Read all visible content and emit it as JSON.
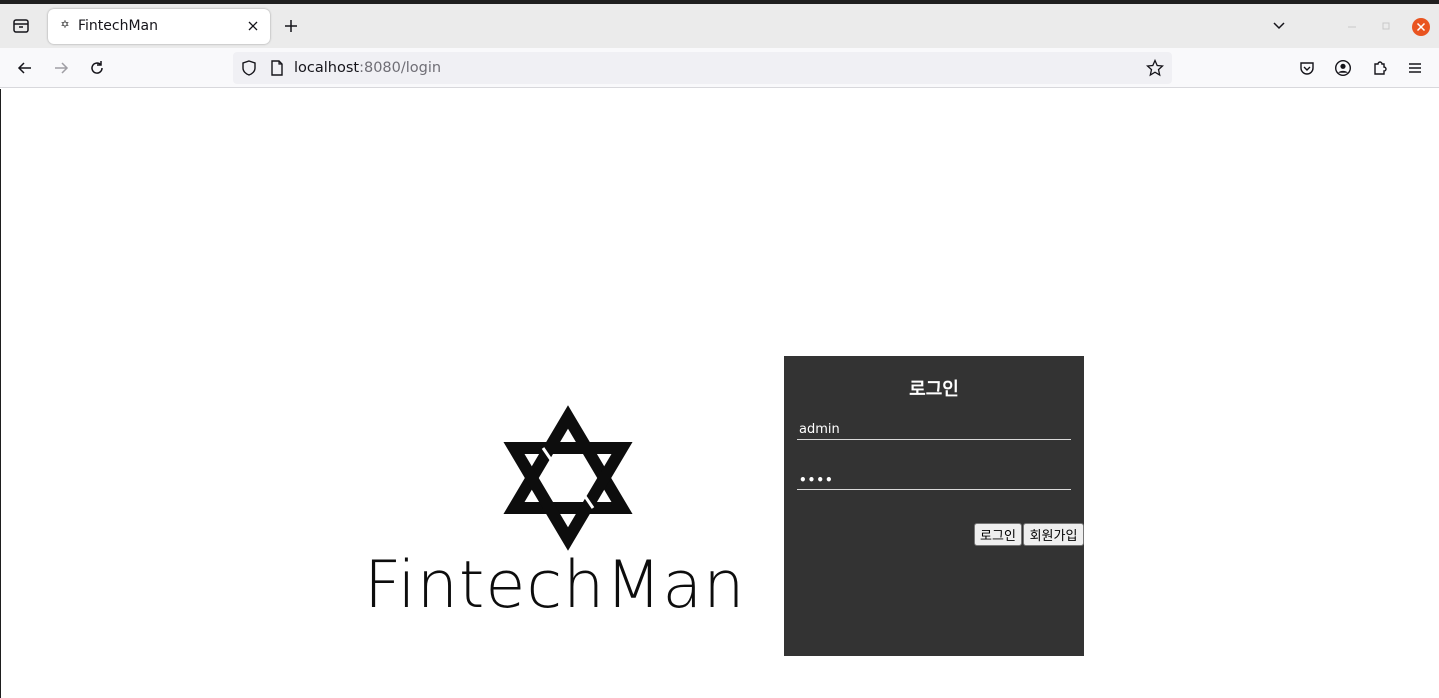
{
  "browser": {
    "tab": {
      "title": "FintechMan",
      "favicon": "✡"
    },
    "url": {
      "host": "localhost",
      "rest": ":8080/login"
    },
    "icons": {
      "tab_overview": "tab-overview-icon",
      "close": "close-icon",
      "new_tab": "plus-icon",
      "list_all_tabs": "chevron-down-icon",
      "back": "back-arrow-icon",
      "forward": "forward-arrow-icon",
      "reload": "reload-icon",
      "tracking_protection": "shield-icon",
      "page_info": "page-icon",
      "bookmark": "star-icon",
      "pocket": "pocket-icon",
      "account": "account-icon",
      "extensions": "puzzle-icon",
      "menu": "hamburger-menu-icon"
    },
    "close_button_color": "#e95420"
  },
  "page": {
    "logo_text": "FintechMan",
    "login": {
      "title": "로그인",
      "username_value": "admin",
      "password_value": "••••",
      "login_button": "로그인",
      "signup_button": "회원가입"
    },
    "panel_color": "#333333"
  }
}
